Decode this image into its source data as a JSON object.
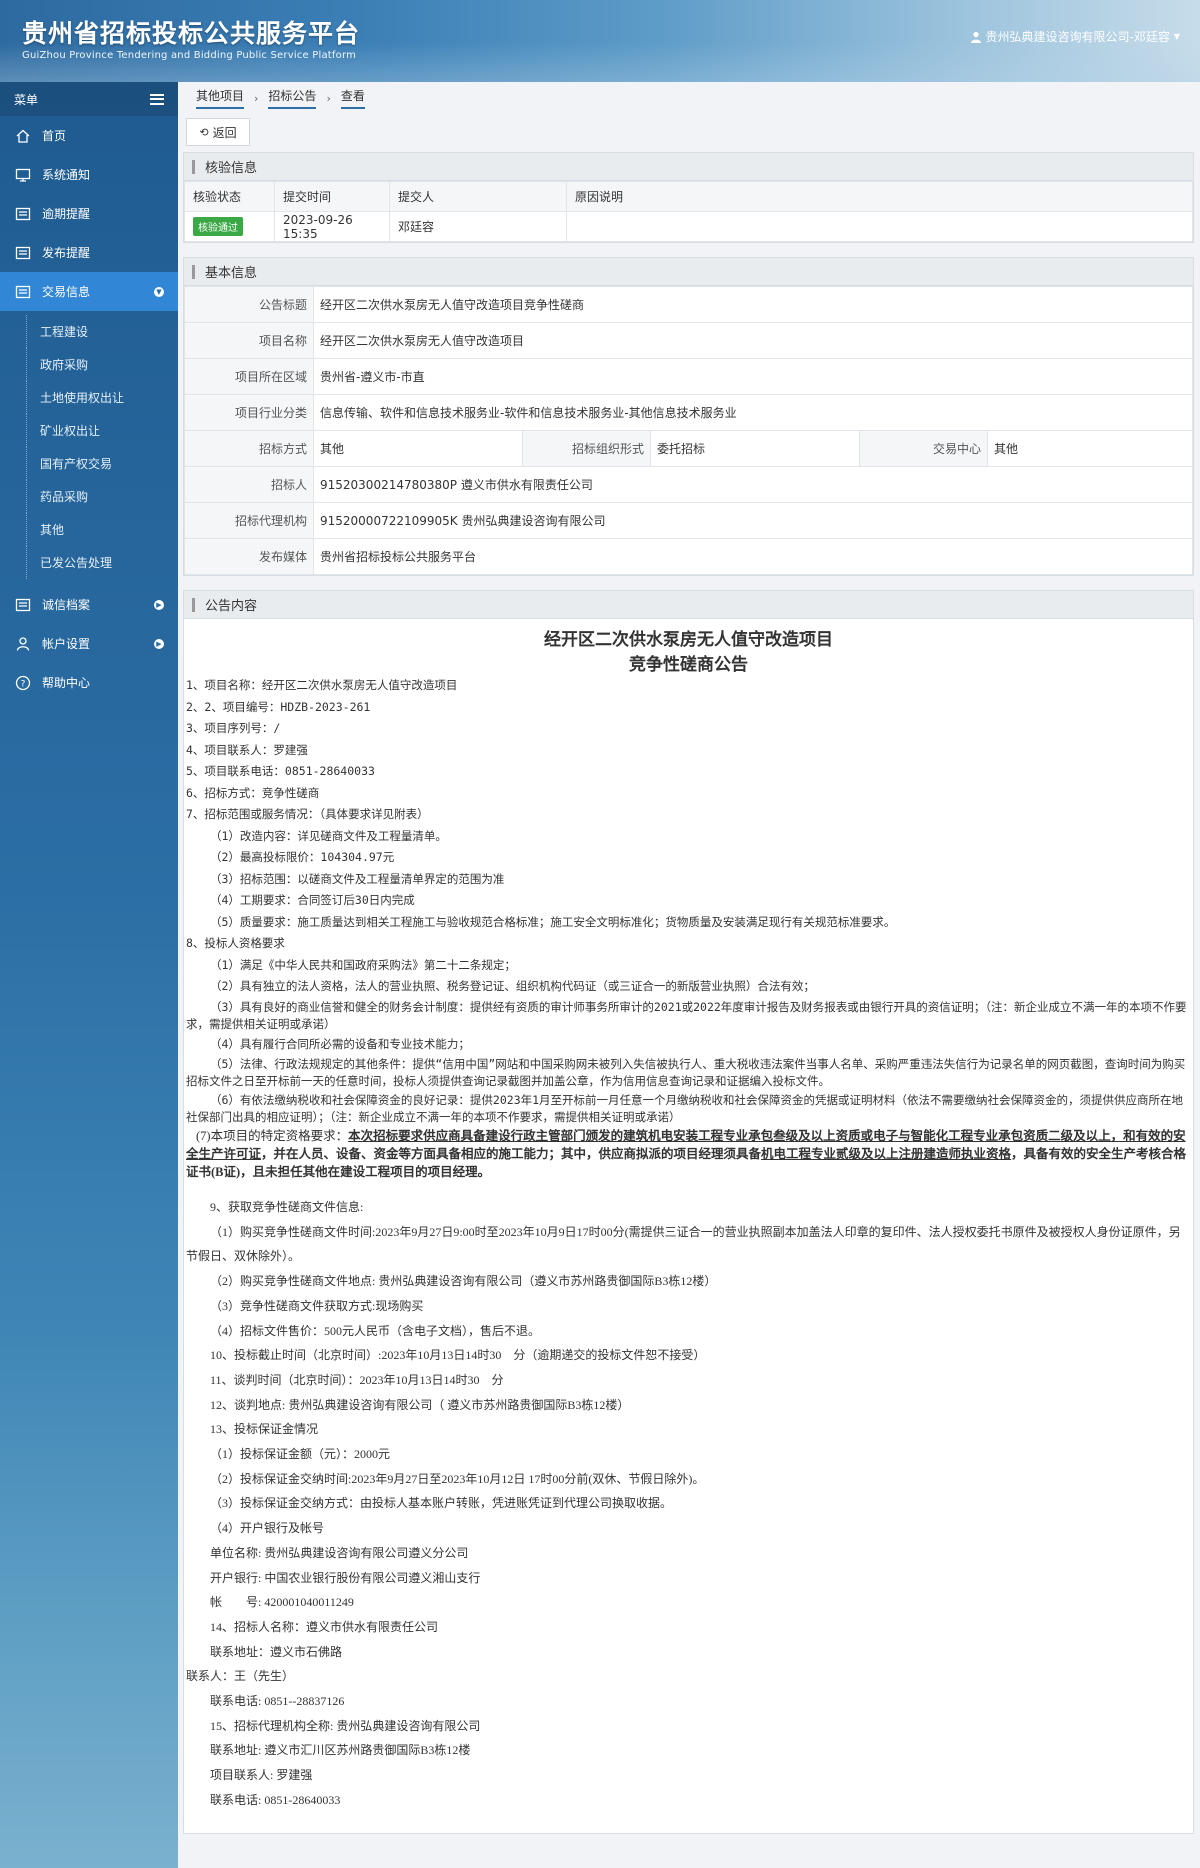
{
  "header": {
    "title": "贵州省招标投标公共服务平台",
    "subtitle": "GuiZhou Province Tendering and Bidding Public Service Platform",
    "user": "贵州弘典建设咨询有限公司-邓廷容"
  },
  "sidebar": {
    "menu_label": "菜单",
    "items": [
      {
        "label": "首页",
        "icon": "home-icon"
      },
      {
        "label": "系统通知",
        "icon": "monitor-icon"
      },
      {
        "label": "逾期提醒",
        "icon": "list-icon"
      },
      {
        "label": "发布提醒",
        "icon": "list-icon"
      },
      {
        "label": "交易信息",
        "icon": "list-icon"
      },
      {
        "label": "诚信档案",
        "icon": "list-icon"
      },
      {
        "label": "帐户设置",
        "icon": "user-icon"
      },
      {
        "label": "帮助中心",
        "icon": "help-icon"
      }
    ],
    "sub_items": [
      "工程建设",
      "政府采购",
      "土地使用权出让",
      "矿业权出让",
      "国有产权交易",
      "药品采购",
      "其他",
      "已发公告处理"
    ]
  },
  "breadcrumb": [
    "其他项目",
    "招标公告",
    "查看"
  ],
  "back_label": "返回",
  "verify": {
    "title": "核验信息",
    "headers": [
      "核验状态",
      "提交时间",
      "提交人",
      "原因说明"
    ],
    "status": "核验通过",
    "time": "2023-09-26 15:35",
    "submitter": "邓廷容",
    "reason": ""
  },
  "basic": {
    "title": "基本信息",
    "rows": {
      "notice_title_label": "公告标题",
      "notice_title": "经开区二次供水泵房无人值守改造项目竞争性磋商",
      "project_name_label": "项目名称",
      "project_name": "经开区二次供水泵房无人值守改造项目",
      "region_label": "项目所在区域",
      "region": "贵州省-遵义市-市直",
      "industry_label": "项目行业分类",
      "industry": "信息传输、软件和信息技术服务业-软件和信息技术服务业-其他信息技术服务业",
      "method_label": "招标方式",
      "method": "其他",
      "org_form_label": "招标组织形式",
      "org_form": "委托招标",
      "center_label": "交易中心",
      "center": "其他",
      "tenderer_label": "招标人",
      "tenderer": "91520300214780380P 遵义市供水有限责任公司",
      "agency_label": "招标代理机构",
      "agency": "91520000722109905K 贵州弘典建设咨询有限公司",
      "media_label": "发布媒体",
      "media": "贵州省招标投标公共服务平台"
    }
  },
  "notice": {
    "section_title": "公告内容",
    "title1": "经开区二次供水泵房无人值守改造项目",
    "title2": "竞争性磋商公告",
    "lines": [
      "1、项目名称：经开区二次供水泵房无人值守改造项目",
      "2、2、项目编号：HDZB-2023-261",
      "3、项目序列号：/",
      "4、项目联系人：罗建强",
      "5、项目联系电话：0851-28640033",
      "6、招标方式：竞争性磋商",
      "7、招标范围或服务情况：（具体要求详见附表）"
    ],
    "scope": [
      "（1）改造内容：详见磋商文件及工程量清单。",
      "（2）最高投标限价：104304.97元",
      "（3）招标范围：以磋商文件及工程量清单界定的范围为准",
      "（4）工期要求：合同签订后30日内完成",
      "（5）质量要求：施工质量达到相关工程施工与验收规范合格标准；施工安全文明标准化；货物质量及安装满足现行有关规范标准要求。"
    ],
    "req_title": "8、投标人资格要求",
    "req1": "（1）满足《中华人民共和国政府采购法》第二十二条规定；",
    "req2": "（2）具有独立的法人资格，法人的营业执照、税务登记证、组织机构代码证（或三证合一的新版营业执照）合法有效；",
    "req3": "（3）具有良好的商业信誉和健全的财务会计制度：提供经有资质的审计师事务所审计的2021或2022年度审计报告及财务报表或由银行开具的资信证明；（注：新企业成立不满一年的本项不作要求，需提供相关证明或承诺）",
    "req4": "（4）具有履行合同所必需的设备和专业技术能力；",
    "req5": "（5）法律、行政法规规定的其他条件：提供“信用中国”网站和中国采购网未被列入失信被执行人、重大税收违法案件当事人名单、采购严重违法失信行为记录名单的网页截图，查询时间为购买招标文件之日至开标前一天的任意时间，投标人须提供查询记录截图并加盖公章，作为信用信息查询记录和证据编入投标文件。",
    "req6": "（6）有依法缴纳税收和社会保障资金的良好记录：提供2023年1月至开标前一月任意一个月缴纳税收和社会保障资金的凭据或证明材料（依法不需要缴纳社会保障资金的，须提供供应商所在地社保部门出具的相应证明）；（注：新企业成立不满一年的本项不作要求，需提供相关证明或承诺）",
    "req7_prefix": "(7)本项目的特定资格要求：",
    "req7_u": "本次招标要求供应商具备建设行政主管部门颁发的建筑机电安装工程专业承包叁级及以上资质或电子与智能化工程专业承包资质二级及以上，和有效的安全生产许可证",
    "req7_mid": "，并在人员、设备、资金等方面具备相应的施工能力；其中，供应商拟派的项目经理须具备",
    "req7_u2": "机电工程专业贰级及以上注册建造师执业资格",
    "req7_end": "，具备有效的安全生产考核合格证书(B证)，且未担任其他在建设工程项目的项目经理。",
    "s9": [
      "9、获取竞争性磋商文件信息:",
      "（1）购买竞争性磋商文件时间:2023年9月27日9:00时至2023年10月9日17时00分(需提供三证合一的营业执照副本加盖法人印章的复印件、法人授权委托书原件及被授权人身份证原件，另节假日、双休除外）。",
      "（2）购买竞争性磋商文件地点: 贵州弘典建设咨询有限公司（遵义市苏州路贵御国际B3栋12楼）",
      "（3）竞争性磋商文件获取方式:现场购买",
      "（4）招标文件售价：500元人民币（含电子文档），售后不退。",
      "10、投标截止时间（北京时间）:2023年10月13日14时30　分（逾期递交的投标文件恕不接受）",
      "11、谈判时间（北京时间）：2023年10月13日14时30　分",
      "12、谈判地点: 贵州弘典建设咨询有限公司（ 遵义市苏州路贵御国际B3栋12楼）",
      "13、投标保证金情况",
      "（1）投标保证金额（元）：2000元",
      "（2）投标保证金交纳时间:2023年9月27日至2023年10月12日 17时00分前(双休、节假日除外)。",
      "（3）投标保证金交纳方式：由投标人基本账户转账，凭进账凭证到代理公司换取收据。",
      "（4）开户银行及帐号",
      "单位名称: 贵州弘典建设咨询有限公司遵义分公司",
      "开户银行: 中国农业银行股份有限公司遵义湘山支行",
      "帐　　号: 420001040011249",
      "14、招标人名称：遵义市供水有限责任公司",
      "联系地址：遵义市石佛路",
      "联系人：王（先生）",
      "联系电话: 0851--28837126",
      "15、招标代理机构全称: 贵州弘典建设咨询有限公司",
      "联系地址: 遵义市汇川区苏州路贵御国际B3栋12楼",
      "项目联系人: 罗建强",
      "联系电话: 0851-28640033"
    ]
  }
}
